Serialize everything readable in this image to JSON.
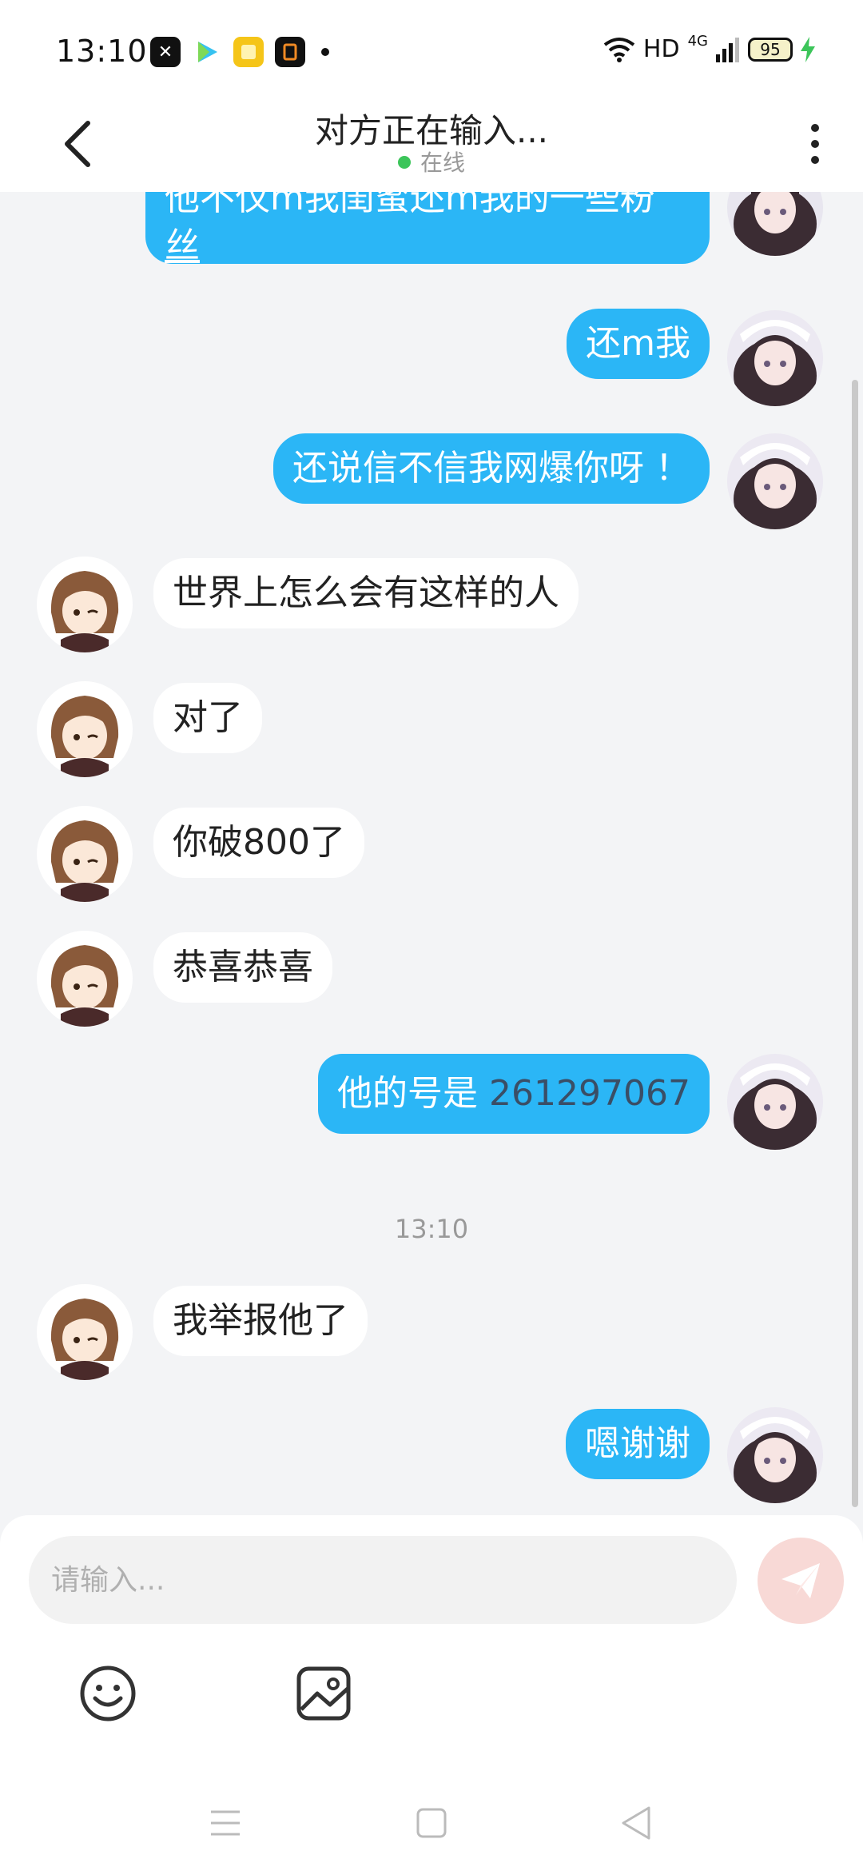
{
  "status_bar": {
    "time": "13:10",
    "network": "HD",
    "battery": "95",
    "signal_type": "4G"
  },
  "header": {
    "title": "对方正在输入...",
    "presence": "在线",
    "presence_color": "#3cc55a"
  },
  "messages": [
    {
      "side": "out",
      "text_partial": "他不仅m我闺蜜还m我的一些粉"
    },
    {
      "side": "out",
      "text": "丝"
    },
    {
      "side": "out",
      "text": "还m我"
    },
    {
      "side": "out",
      "text": "还说信不信我网爆你呀 ！"
    },
    {
      "side": "in",
      "text": "世界上怎么会有这样的人"
    },
    {
      "side": "in",
      "text": "对了"
    },
    {
      "side": "in",
      "text": "你破800了"
    },
    {
      "side": "in",
      "text": "恭喜恭喜"
    },
    {
      "side": "out",
      "text": "他的号是 ",
      "number": "261297067"
    },
    {
      "side": "in",
      "text": "我举报他了"
    },
    {
      "side": "out",
      "text": "嗯谢谢"
    }
  ],
  "timestamp": "13:10",
  "composer": {
    "placeholder": "请输入..."
  },
  "colors": {
    "outgoing_bubble": "#2bb6f6",
    "incoming_bubble": "#ffffff",
    "send_button": "#f8d9d6"
  }
}
